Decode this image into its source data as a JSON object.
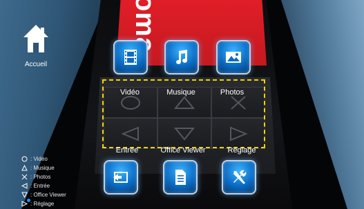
{
  "brand": "oma",
  "home": {
    "label": "Accueil",
    "icon": "house-icon"
  },
  "top_buttons": [
    {
      "label": "Vidéo",
      "icon": "film-icon"
    },
    {
      "label": "Musique",
      "icon": "music-note-icon"
    },
    {
      "label": "Photos",
      "icon": "photo-icon"
    }
  ],
  "bottom_buttons": [
    {
      "label": "Entrée",
      "icon": "input-icon"
    },
    {
      "label": "Office Viewer",
      "icon": "document-icon"
    },
    {
      "label": "Réglage",
      "icon": "tools-icon"
    }
  ],
  "legend": [
    {
      "symbol": "circle",
      "text": "Vidéo"
    },
    {
      "symbol": "triangle-up",
      "text": "Musique"
    },
    {
      "symbol": "cross",
      "text": "Photos"
    },
    {
      "symbol": "triangle-left",
      "text": "Entrée"
    },
    {
      "symbol": "triangle-down",
      "text": "Office Viewer"
    },
    {
      "symbol": "triangle-right",
      "text": "Réglage"
    }
  ],
  "colors": {
    "accent_red": "#e01e27",
    "button_blue": "#0a6bc4",
    "selection_yellow": "#f2d400"
  }
}
